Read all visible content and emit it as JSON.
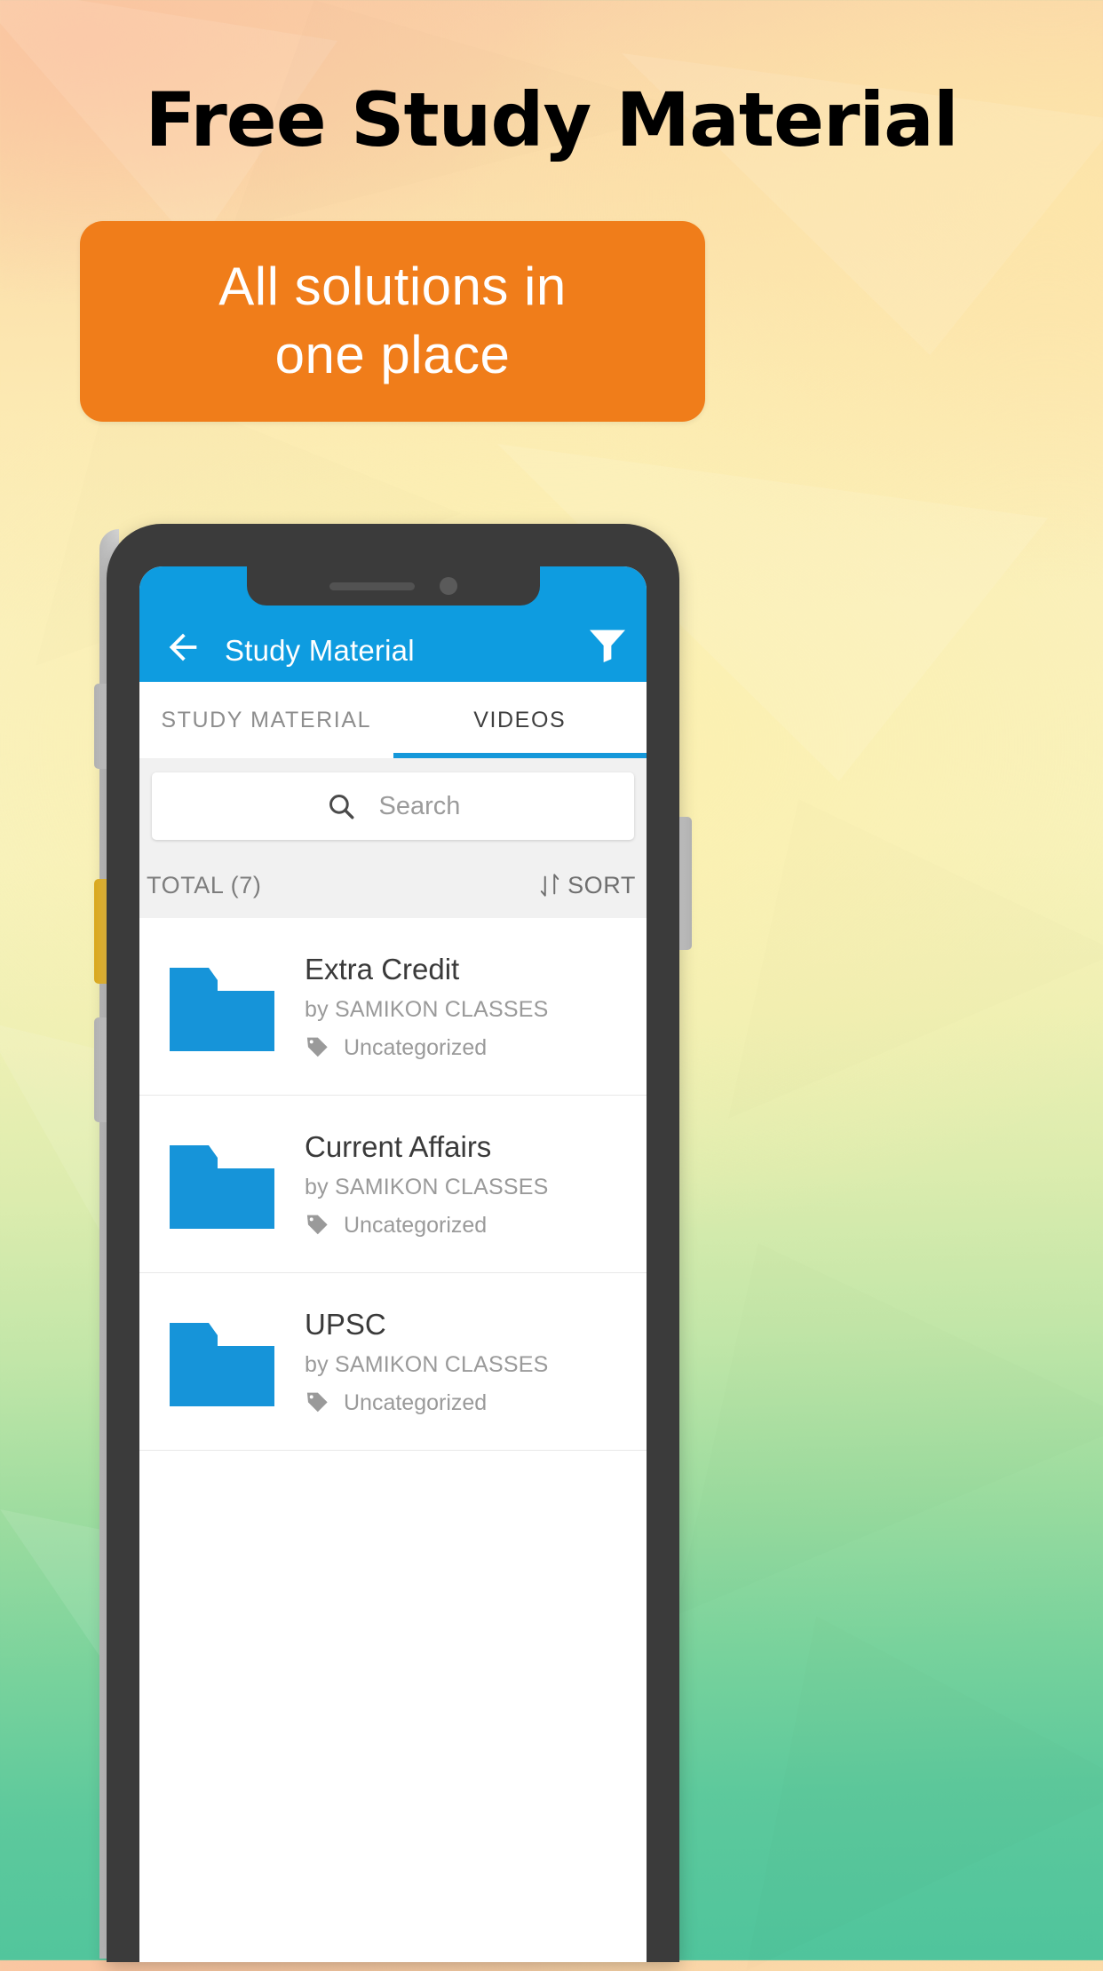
{
  "poster": {
    "headline": "Free Study Material",
    "banner_text": "All solutions in\none place",
    "colors": {
      "banner_bg": "#f07d1a",
      "app_primary": "#0e9ce0",
      "folder": "#1694d9"
    }
  },
  "app": {
    "appbar": {
      "back_icon": "arrow-left-icon",
      "title": "Study Material",
      "filter_icon": "filter-icon"
    },
    "tabs": [
      {
        "label": "STUDY MATERIAL",
        "active": false
      },
      {
        "label": "VIDEOS",
        "active": true
      }
    ],
    "search": {
      "icon": "search-icon",
      "placeholder": "Search",
      "value": ""
    },
    "toolbar": {
      "total_label": "TOTAL (7)",
      "sort_label": "SORT",
      "sort_icon": "sort-icon"
    },
    "list": {
      "items": [
        {
          "icon": "folder-icon",
          "title": "Extra Credit",
          "subtitle": "by SAMIKON CLASSES",
          "tag_icon": "tag-icon",
          "tag": "Uncategorized"
        },
        {
          "icon": "folder-icon",
          "title": "Current Affairs",
          "subtitle": "by SAMIKON CLASSES",
          "tag_icon": "tag-icon",
          "tag": "Uncategorized"
        },
        {
          "icon": "folder-icon",
          "title": "UPSC",
          "subtitle": "by SAMIKON CLASSES",
          "tag_icon": "tag-icon",
          "tag": "Uncategorized"
        }
      ]
    }
  }
}
